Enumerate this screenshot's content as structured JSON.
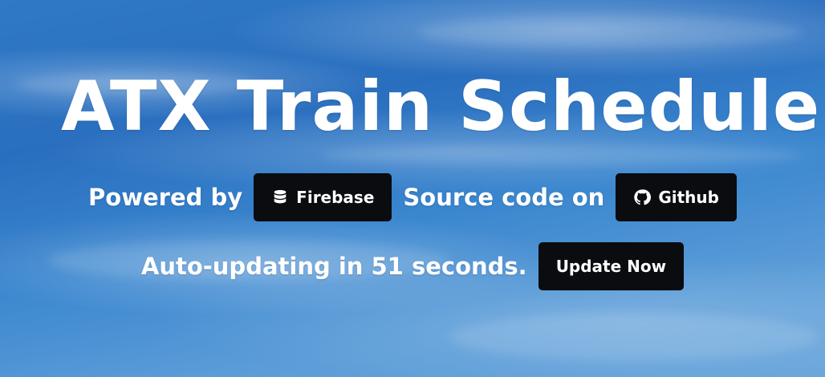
{
  "title": "ATX Train Schedule",
  "powered": {
    "lead": "Powered by",
    "firebase_label": "Firebase",
    "firebase_icon": "database-icon"
  },
  "source": {
    "lead": "Source code on",
    "github_label": "Github",
    "github_icon": "github-icon"
  },
  "refresh": {
    "status": "Auto-updating in 51 seconds.",
    "button_label": "Update Now"
  },
  "colors": {
    "button_bg": "#0a0c0f",
    "text": "#ffffff",
    "sky": "#2f79c6"
  }
}
